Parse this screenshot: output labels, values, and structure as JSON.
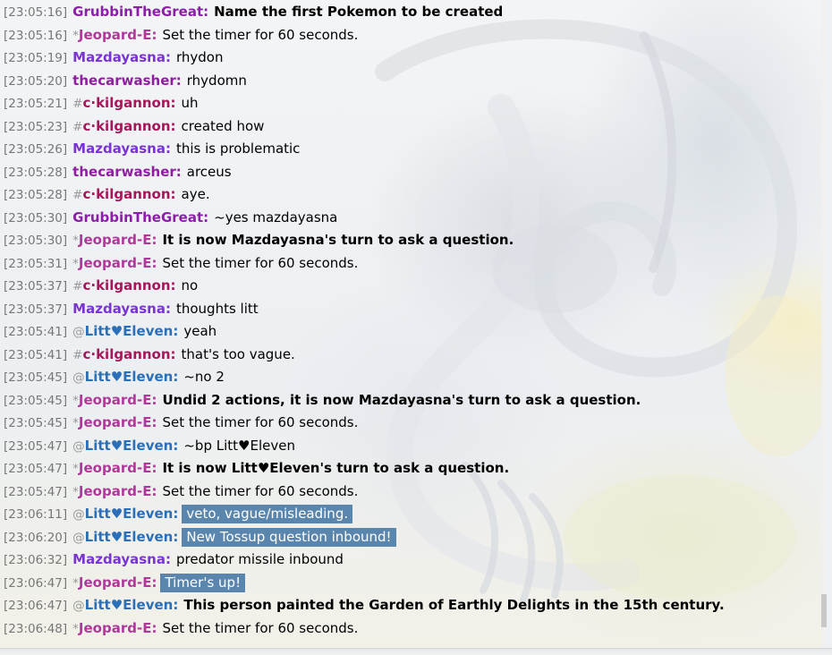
{
  "colors": {
    "timestamp": "#777777",
    "rank": "#999999",
    "highlight_bg": "#5a86ad",
    "highlight_fg": "#ffffff"
  },
  "messages": [
    {
      "time": "[23:05:16]",
      "rank": "",
      "user": "GrubbinTheGreat",
      "user_color": "#8b1fa8",
      "text": "Name the first Pokemon to be created",
      "style": "bold"
    },
    {
      "time": "[23:05:16]",
      "rank": "*",
      "user": "Jeopard-E",
      "user_color": "#b0389a",
      "text": "Set the timer for 60 seconds.",
      "style": "normal"
    },
    {
      "time": "[23:05:19]",
      "rank": "",
      "user": "Mazdayasna",
      "user_color": "#7a34d6",
      "text": "rhydon",
      "style": "normal"
    },
    {
      "time": "[23:05:20]",
      "rank": "",
      "user": "thecarwasher",
      "user_color": "#8f1fa0",
      "text": "rhydomn",
      "style": "normal"
    },
    {
      "time": "[23:05:21]",
      "rank": "#",
      "user": "c·kilgannon",
      "user_color": "#a8165a",
      "text": "uh",
      "style": "normal"
    },
    {
      "time": "[23:05:23]",
      "rank": "#",
      "user": "c·kilgannon",
      "user_color": "#a8165a",
      "text": "created how",
      "style": "normal"
    },
    {
      "time": "[23:05:26]",
      "rank": "",
      "user": "Mazdayasna",
      "user_color": "#7a34d6",
      "text": "this is problematic",
      "style": "normal"
    },
    {
      "time": "[23:05:28]",
      "rank": "",
      "user": "thecarwasher",
      "user_color": "#8f1fa0",
      "text": "arceus",
      "style": "normal"
    },
    {
      "time": "[23:05:28]",
      "rank": "#",
      "user": "c·kilgannon",
      "user_color": "#a8165a",
      "text": "aye.",
      "style": "normal"
    },
    {
      "time": "[23:05:30]",
      "rank": "",
      "user": "GrubbinTheGreat",
      "user_color": "#8b1fa8",
      "text": "~yes mazdayasna",
      "style": "normal"
    },
    {
      "time": "[23:05:30]",
      "rank": "*",
      "user": "Jeopard-E",
      "user_color": "#b0389a",
      "text": "It is now Mazdayasna's turn to ask a question.",
      "style": "bold"
    },
    {
      "time": "[23:05:31]",
      "rank": "*",
      "user": "Jeopard-E",
      "user_color": "#b0389a",
      "text": "Set the timer for 60 seconds.",
      "style": "normal"
    },
    {
      "time": "[23:05:37]",
      "rank": "#",
      "user": "c·kilgannon",
      "user_color": "#a8165a",
      "text": "no",
      "style": "normal"
    },
    {
      "time": "[23:05:37]",
      "rank": "",
      "user": "Mazdayasna",
      "user_color": "#7a34d6",
      "text": "thoughts litt",
      "style": "normal"
    },
    {
      "time": "[23:05:41]",
      "rank": "@",
      "user": "Litt♥Eleven",
      "user_color": "#2a6fb8",
      "text": "yeah",
      "style": "normal"
    },
    {
      "time": "[23:05:41]",
      "rank": "#",
      "user": "c·kilgannon",
      "user_color": "#a8165a",
      "text": "that's too vague.",
      "style": "normal"
    },
    {
      "time": "[23:05:45]",
      "rank": "@",
      "user": "Litt♥Eleven",
      "user_color": "#2a6fb8",
      "text": "~no 2",
      "style": "normal"
    },
    {
      "time": "[23:05:45]",
      "rank": "*",
      "user": "Jeopard-E",
      "user_color": "#b0389a",
      "text": "Undid 2 actions, it is now Mazdayasna's turn to ask a question.",
      "style": "bold"
    },
    {
      "time": "[23:05:45]",
      "rank": "*",
      "user": "Jeopard-E",
      "user_color": "#b0389a",
      "text": "Set the timer for 60 seconds.",
      "style": "normal"
    },
    {
      "time": "[23:05:47]",
      "rank": "@",
      "user": "Litt♥Eleven",
      "user_color": "#2a6fb8",
      "text": "~bp Litt♥Eleven",
      "style": "normal"
    },
    {
      "time": "[23:05:47]",
      "rank": "*",
      "user": "Jeopard-E",
      "user_color": "#b0389a",
      "text": "It is now Litt♥Eleven's turn to ask a question.",
      "style": "bold"
    },
    {
      "time": "[23:05:47]",
      "rank": "*",
      "user": "Jeopard-E",
      "user_color": "#b0389a",
      "text": "Set the timer for 60 seconds.",
      "style": "normal"
    },
    {
      "time": "[23:06:11]",
      "rank": "@",
      "user": "Litt♥Eleven",
      "user_color": "#2a6fb8",
      "text": "veto, vague/misleading.",
      "style": "highlight"
    },
    {
      "time": "[23:06:20]",
      "rank": "@",
      "user": "Litt♥Eleven",
      "user_color": "#2a6fb8",
      "text": "New Tossup question inbound!",
      "style": "highlight"
    },
    {
      "time": "[23:06:32]",
      "rank": "",
      "user": "Mazdayasna",
      "user_color": "#7a34d6",
      "text": "predator missile inbound",
      "style": "normal"
    },
    {
      "time": "[23:06:47]",
      "rank": "*",
      "user": "Jeopard-E",
      "user_color": "#b0389a",
      "text": "Timer's up!",
      "style": "highlight"
    },
    {
      "time": "[23:06:47]",
      "rank": "@",
      "user": "Litt♥Eleven",
      "user_color": "#2a6fb8",
      "text": "This person painted the Garden of Earthly Delights in the 15th century.",
      "style": "bold"
    },
    {
      "time": "[23:06:48]",
      "rank": "*",
      "user": "Jeopard-E",
      "user_color": "#b0389a",
      "text": "Set the timer for 60 seconds.",
      "style": "normal"
    }
  ]
}
